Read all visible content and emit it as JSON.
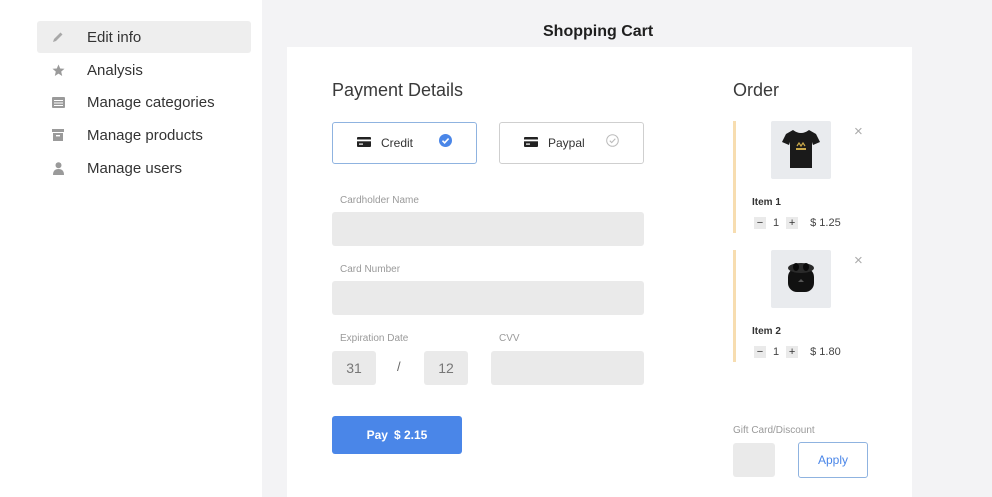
{
  "header": {
    "title": "Shopping Cart"
  },
  "sidebar": {
    "items": [
      {
        "label": "Edit info",
        "icon": "pencil-icon",
        "active": true
      },
      {
        "label": "Analysis",
        "icon": "star-icon"
      },
      {
        "label": "Manage categories",
        "icon": "list-icon"
      },
      {
        "label": "Manage products",
        "icon": "archive-icon"
      },
      {
        "label": "Manage users",
        "icon": "user-icon"
      }
    ]
  },
  "payment": {
    "title": "Payment Details",
    "methods": [
      {
        "label": "Credit",
        "selected": true
      },
      {
        "label": "Paypal",
        "selected": false
      }
    ],
    "cardholder_label": "Cardholder Name",
    "card_number_label": "Card Number",
    "expiration_label": "Expiration Date",
    "exp_day": "31",
    "exp_separator": "/",
    "exp_month": "12",
    "cvv_label": "CVV",
    "pay_label": "Pay",
    "pay_amount": "$ 2.15"
  },
  "order": {
    "title": "Order",
    "items": [
      {
        "name": "Item 1",
        "qty": "1",
        "price": "$ 1.25",
        "icon": "tshirt-icon"
      },
      {
        "name": "Item 2",
        "qty": "1",
        "price": "$ 1.80",
        "icon": "earbuds-icon"
      }
    ],
    "remove_symbol": "×",
    "minus": "−",
    "plus": "+",
    "gift_label": "Gift Card/Discount",
    "apply_label": "Apply"
  },
  "colors": {
    "accent": "#4a86e8",
    "order_border": "#f7ddb0",
    "field_bg": "#eaeaea"
  }
}
